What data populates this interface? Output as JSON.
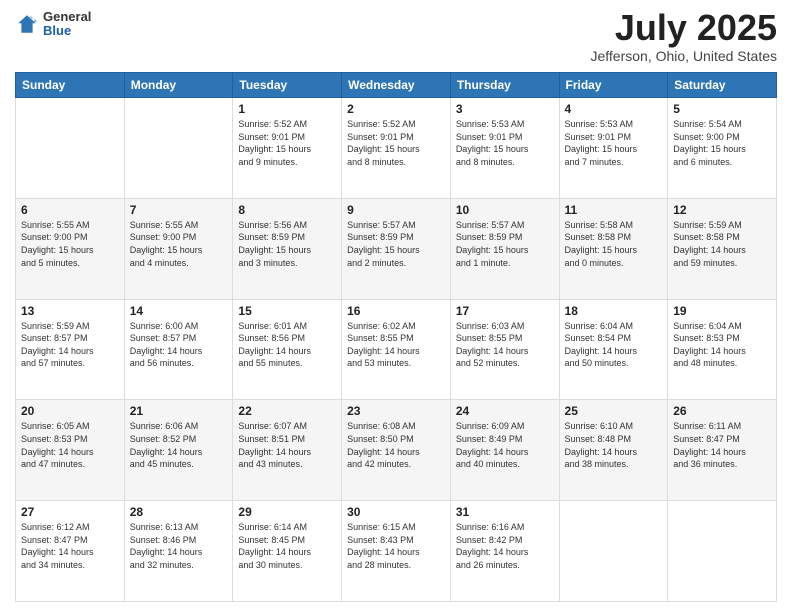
{
  "header": {
    "logo_general": "General",
    "logo_blue": "Blue",
    "main_title": "July 2025",
    "subtitle": "Jefferson, Ohio, United States"
  },
  "weekdays": [
    "Sunday",
    "Monday",
    "Tuesday",
    "Wednesday",
    "Thursday",
    "Friday",
    "Saturday"
  ],
  "weeks": [
    [
      {
        "day": "",
        "info": ""
      },
      {
        "day": "",
        "info": ""
      },
      {
        "day": "1",
        "info": "Sunrise: 5:52 AM\nSunset: 9:01 PM\nDaylight: 15 hours\nand 9 minutes."
      },
      {
        "day": "2",
        "info": "Sunrise: 5:52 AM\nSunset: 9:01 PM\nDaylight: 15 hours\nand 8 minutes."
      },
      {
        "day": "3",
        "info": "Sunrise: 5:53 AM\nSunset: 9:01 PM\nDaylight: 15 hours\nand 8 minutes."
      },
      {
        "day": "4",
        "info": "Sunrise: 5:53 AM\nSunset: 9:01 PM\nDaylight: 15 hours\nand 7 minutes."
      },
      {
        "day": "5",
        "info": "Sunrise: 5:54 AM\nSunset: 9:00 PM\nDaylight: 15 hours\nand 6 minutes."
      }
    ],
    [
      {
        "day": "6",
        "info": "Sunrise: 5:55 AM\nSunset: 9:00 PM\nDaylight: 15 hours\nand 5 minutes."
      },
      {
        "day": "7",
        "info": "Sunrise: 5:55 AM\nSunset: 9:00 PM\nDaylight: 15 hours\nand 4 minutes."
      },
      {
        "day": "8",
        "info": "Sunrise: 5:56 AM\nSunset: 8:59 PM\nDaylight: 15 hours\nand 3 minutes."
      },
      {
        "day": "9",
        "info": "Sunrise: 5:57 AM\nSunset: 8:59 PM\nDaylight: 15 hours\nand 2 minutes."
      },
      {
        "day": "10",
        "info": "Sunrise: 5:57 AM\nSunset: 8:59 PM\nDaylight: 15 hours\nand 1 minute."
      },
      {
        "day": "11",
        "info": "Sunrise: 5:58 AM\nSunset: 8:58 PM\nDaylight: 15 hours\nand 0 minutes."
      },
      {
        "day": "12",
        "info": "Sunrise: 5:59 AM\nSunset: 8:58 PM\nDaylight: 14 hours\nand 59 minutes."
      }
    ],
    [
      {
        "day": "13",
        "info": "Sunrise: 5:59 AM\nSunset: 8:57 PM\nDaylight: 14 hours\nand 57 minutes."
      },
      {
        "day": "14",
        "info": "Sunrise: 6:00 AM\nSunset: 8:57 PM\nDaylight: 14 hours\nand 56 minutes."
      },
      {
        "day": "15",
        "info": "Sunrise: 6:01 AM\nSunset: 8:56 PM\nDaylight: 14 hours\nand 55 minutes."
      },
      {
        "day": "16",
        "info": "Sunrise: 6:02 AM\nSunset: 8:55 PM\nDaylight: 14 hours\nand 53 minutes."
      },
      {
        "day": "17",
        "info": "Sunrise: 6:03 AM\nSunset: 8:55 PM\nDaylight: 14 hours\nand 52 minutes."
      },
      {
        "day": "18",
        "info": "Sunrise: 6:04 AM\nSunset: 8:54 PM\nDaylight: 14 hours\nand 50 minutes."
      },
      {
        "day": "19",
        "info": "Sunrise: 6:04 AM\nSunset: 8:53 PM\nDaylight: 14 hours\nand 48 minutes."
      }
    ],
    [
      {
        "day": "20",
        "info": "Sunrise: 6:05 AM\nSunset: 8:53 PM\nDaylight: 14 hours\nand 47 minutes."
      },
      {
        "day": "21",
        "info": "Sunrise: 6:06 AM\nSunset: 8:52 PM\nDaylight: 14 hours\nand 45 minutes."
      },
      {
        "day": "22",
        "info": "Sunrise: 6:07 AM\nSunset: 8:51 PM\nDaylight: 14 hours\nand 43 minutes."
      },
      {
        "day": "23",
        "info": "Sunrise: 6:08 AM\nSunset: 8:50 PM\nDaylight: 14 hours\nand 42 minutes."
      },
      {
        "day": "24",
        "info": "Sunrise: 6:09 AM\nSunset: 8:49 PM\nDaylight: 14 hours\nand 40 minutes."
      },
      {
        "day": "25",
        "info": "Sunrise: 6:10 AM\nSunset: 8:48 PM\nDaylight: 14 hours\nand 38 minutes."
      },
      {
        "day": "26",
        "info": "Sunrise: 6:11 AM\nSunset: 8:47 PM\nDaylight: 14 hours\nand 36 minutes."
      }
    ],
    [
      {
        "day": "27",
        "info": "Sunrise: 6:12 AM\nSunset: 8:47 PM\nDaylight: 14 hours\nand 34 minutes."
      },
      {
        "day": "28",
        "info": "Sunrise: 6:13 AM\nSunset: 8:46 PM\nDaylight: 14 hours\nand 32 minutes."
      },
      {
        "day": "29",
        "info": "Sunrise: 6:14 AM\nSunset: 8:45 PM\nDaylight: 14 hours\nand 30 minutes."
      },
      {
        "day": "30",
        "info": "Sunrise: 6:15 AM\nSunset: 8:43 PM\nDaylight: 14 hours\nand 28 minutes."
      },
      {
        "day": "31",
        "info": "Sunrise: 6:16 AM\nSunset: 8:42 PM\nDaylight: 14 hours\nand 26 minutes."
      },
      {
        "day": "",
        "info": ""
      },
      {
        "day": "",
        "info": ""
      }
    ]
  ]
}
